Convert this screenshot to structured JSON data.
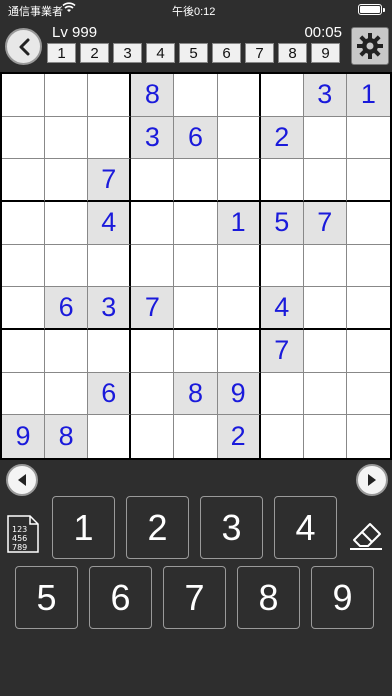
{
  "status_bar": {
    "carrier": "通信事業者",
    "time": "午後0:12",
    "battery_level": 1.0
  },
  "header": {
    "level": "Lv 999",
    "timer": "00:05",
    "digit_counts": [
      "1",
      "2",
      "3",
      "4",
      "5",
      "6",
      "7",
      "8",
      "9"
    ],
    "back_icon": "chevron-left-icon",
    "settings_icon": "gear-icon"
  },
  "board": {
    "rows": [
      [
        "",
        "",
        "",
        "8",
        "",
        "",
        "",
        "3",
        "1"
      ],
      [
        "",
        "",
        "",
        "3",
        "6",
        "",
        "2",
        "",
        ""
      ],
      [
        "",
        "",
        "7",
        "",
        "",
        "",
        "",
        "",
        ""
      ],
      [
        "",
        "",
        "4",
        "",
        "",
        "1",
        "5",
        "7",
        ""
      ],
      [
        "",
        "",
        "",
        "",
        "",
        "",
        "",
        "",
        ""
      ],
      [
        "",
        "6",
        "3",
        "7",
        "",
        "",
        "4",
        "",
        ""
      ],
      [
        "",
        "",
        "",
        "",
        "",
        "",
        "7",
        "",
        ""
      ],
      [
        "",
        "",
        "6",
        "",
        "8",
        "9",
        "",
        "",
        ""
      ],
      [
        "9",
        "8",
        "",
        "",
        "",
        "2",
        "",
        "",
        ""
      ]
    ],
    "colors": {
      "digit": "#1a1adb",
      "given_bg": "#e3e3e3",
      "empty_bg": "#ffffff"
    }
  },
  "numpad": {
    "row1": [
      "1",
      "2",
      "3",
      "4"
    ],
    "row2": [
      "5",
      "6",
      "7",
      "8",
      "9"
    ],
    "memo_icon": "memo-grid-icon",
    "eraser_icon": "eraser-icon"
  },
  "nav": {
    "prev_icon": "arrow-left-icon",
    "next_icon": "arrow-right-icon"
  }
}
